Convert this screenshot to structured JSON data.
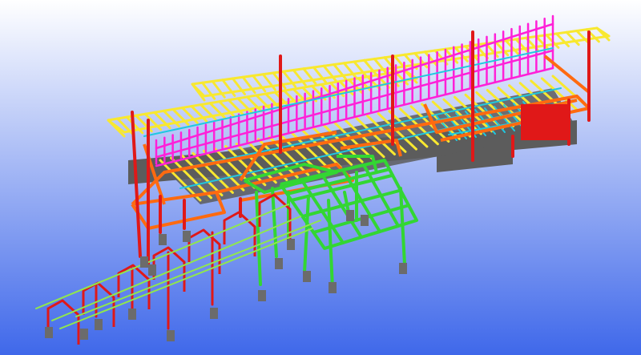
{
  "viewport": {
    "background_top": "#ffffff",
    "background_bottom": "#3f68ea"
  },
  "colors": {
    "slab": "#5c5c5c",
    "column_red": "#e01818",
    "beam_orange": "#ff6a10",
    "bracing_magenta": "#ff20d8",
    "joist_yellow": "#f8e830",
    "purlin_cyan": "#20c8e0",
    "frame_green": "#33d633",
    "rail_lightgreen": "#90e84c",
    "footing_gray": "#6b6b6b"
  },
  "model": {
    "parts": [
      "concrete-slab",
      "steel-columns",
      "orange-perimeter-beams",
      "magenta-bracing",
      "yellow-roof-joists",
      "cyan-purlins",
      "green-canopy-frame",
      "gray-footings",
      "red-portal-frames",
      "light-green-rails"
    ]
  }
}
